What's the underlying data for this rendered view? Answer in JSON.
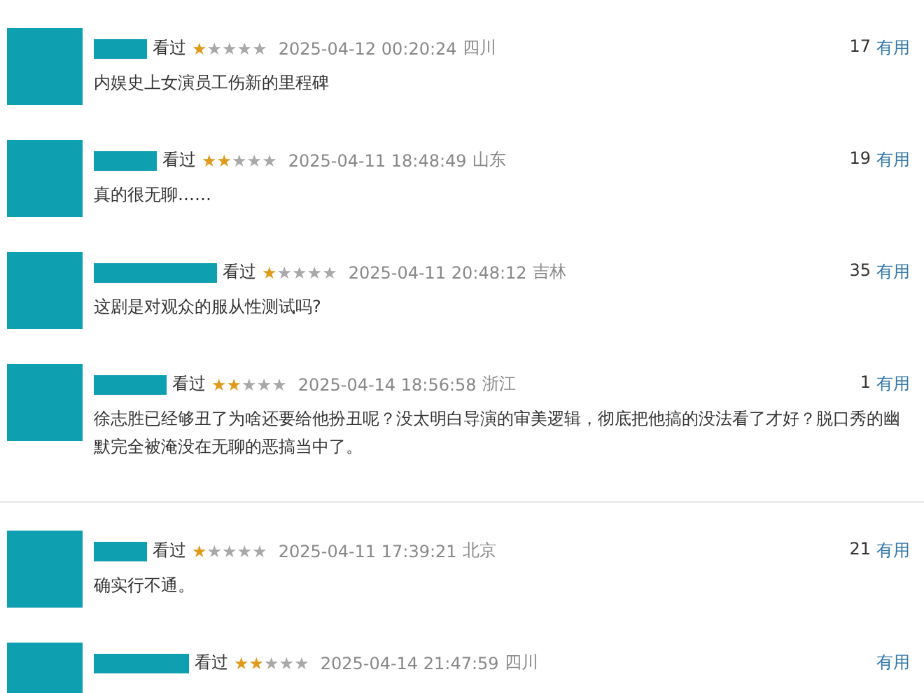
{
  "comments": [
    {
      "status": "看过",
      "stars": 1,
      "time": "2025-04-12 00:20:24",
      "region": "四川",
      "votes": "17",
      "useful": "有用",
      "text": "内娱史上女演员工伤新的里程碑",
      "divider_after": false
    },
    {
      "status": "看过",
      "stars": 2,
      "time": "2025-04-11 18:48:49",
      "region": "山东",
      "votes": "19",
      "useful": "有用",
      "text": "真的很无聊……",
      "divider_after": false
    },
    {
      "status": "看过",
      "stars": 1,
      "time": "2025-04-11 20:48:12",
      "region": "吉林",
      "votes": "35",
      "useful": "有用",
      "text": "这剧是对观众的服从性测试吗?",
      "divider_after": false
    },
    {
      "status": "看过",
      "stars": 2,
      "time": "2025-04-14 18:56:58",
      "region": "浙江",
      "votes": "1",
      "useful": "有用",
      "text": "徐志胜已经够丑了为啥还要给他扮丑呢？没太明白导演的审美逻辑，彻底把他搞的没法看了才好？脱口秀的幽默完全被淹没在无聊的恶搞当中了。",
      "divider_after": true
    },
    {
      "status": "看过",
      "stars": 1,
      "time": "2025-04-11 17:39:21",
      "region": "北京",
      "votes": "21",
      "useful": "有用",
      "text": "确实行不通。",
      "divider_after": false
    },
    {
      "status": "看过",
      "stars": 2,
      "time": "2025-04-14 21:47:59",
      "region": "四川",
      "useful": "有用",
      "divider_after": false
    }
  ]
}
